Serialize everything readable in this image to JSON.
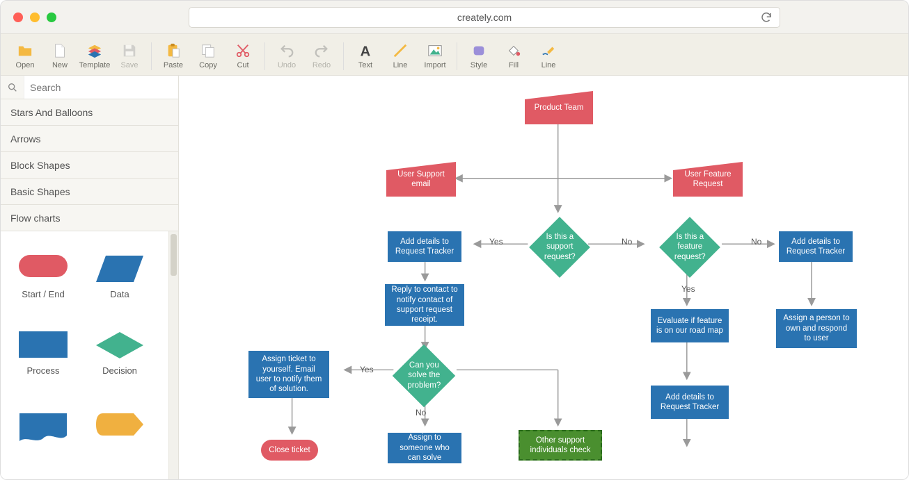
{
  "browser": {
    "url": "creately.com"
  },
  "toolbar": {
    "groups": [
      [
        {
          "id": "open",
          "label": "Open",
          "icon": "folder"
        },
        {
          "id": "new",
          "label": "New",
          "icon": "file"
        },
        {
          "id": "template",
          "label": "Template",
          "icon": "stack"
        },
        {
          "id": "save",
          "label": "Save",
          "icon": "save",
          "disabled": true
        }
      ],
      [
        {
          "id": "paste",
          "label": "Paste",
          "icon": "paste"
        },
        {
          "id": "copy",
          "label": "Copy",
          "icon": "copy"
        },
        {
          "id": "cut",
          "label": "Cut",
          "icon": "cut"
        }
      ],
      [
        {
          "id": "undo",
          "label": "Undo",
          "icon": "undo",
          "disabled": true
        },
        {
          "id": "redo",
          "label": "Redo",
          "icon": "redo",
          "disabled": true
        }
      ],
      [
        {
          "id": "text",
          "label": "Text",
          "icon": "text"
        },
        {
          "id": "line",
          "label": "Line",
          "icon": "line"
        },
        {
          "id": "import",
          "label": "Import",
          "icon": "image"
        }
      ],
      [
        {
          "id": "style",
          "label": "Style",
          "icon": "style"
        },
        {
          "id": "fill",
          "label": "Fill",
          "icon": "fill"
        },
        {
          "id": "line2",
          "label": "Line",
          "icon": "pencil"
        }
      ]
    ]
  },
  "sidebar": {
    "search_placeholder": "Search",
    "categories": [
      "Stars And Balloons",
      "Arrows",
      "Block Shapes",
      "Basic Shapes",
      "Flow charts"
    ],
    "palette": [
      {
        "label": "Start / End",
        "shape": "terminator",
        "color": "#e05a64"
      },
      {
        "label": "Data",
        "shape": "parallelogram",
        "color": "#2a73b1"
      },
      {
        "label": "Process",
        "shape": "rect",
        "color": "#2a73b1"
      },
      {
        "label": "Decision",
        "shape": "diamond",
        "color": "#42b28e"
      },
      {
        "label": "",
        "shape": "document",
        "color": "#2a73b1"
      },
      {
        "label": "",
        "shape": "display",
        "color": "#f0b040"
      }
    ]
  },
  "flow": {
    "nodes": {
      "productTeam": "Product Team",
      "userSupportEmail": "User Support email",
      "userFeatureRequest": "User Feature Request",
      "isSupportReq": "Is this a support request?",
      "isFeatureReq": "Is this a feature request?",
      "addDetails1": "Add details to Request Tracker",
      "addDetails2": "Add details to Request Tracker",
      "addDetails3": "Add details to Request Tracker",
      "replyContact": "Reply to contact to notify contact of support request receipt.",
      "canSolve": "Can you solve the problem?",
      "assignSelf": "Assign ticket to yourself. Email user to notify them of solution.",
      "closeTicket": "Close ticket",
      "assignSomeone": "Assign to someone who can solve",
      "otherSupport": "Other support individuals check",
      "evaluateFeature": "Evaluate if feature is on our road map",
      "assignPerson": "Assign a person to own and respond to user"
    },
    "labels": {
      "yes": "Yes",
      "no": "No"
    }
  }
}
